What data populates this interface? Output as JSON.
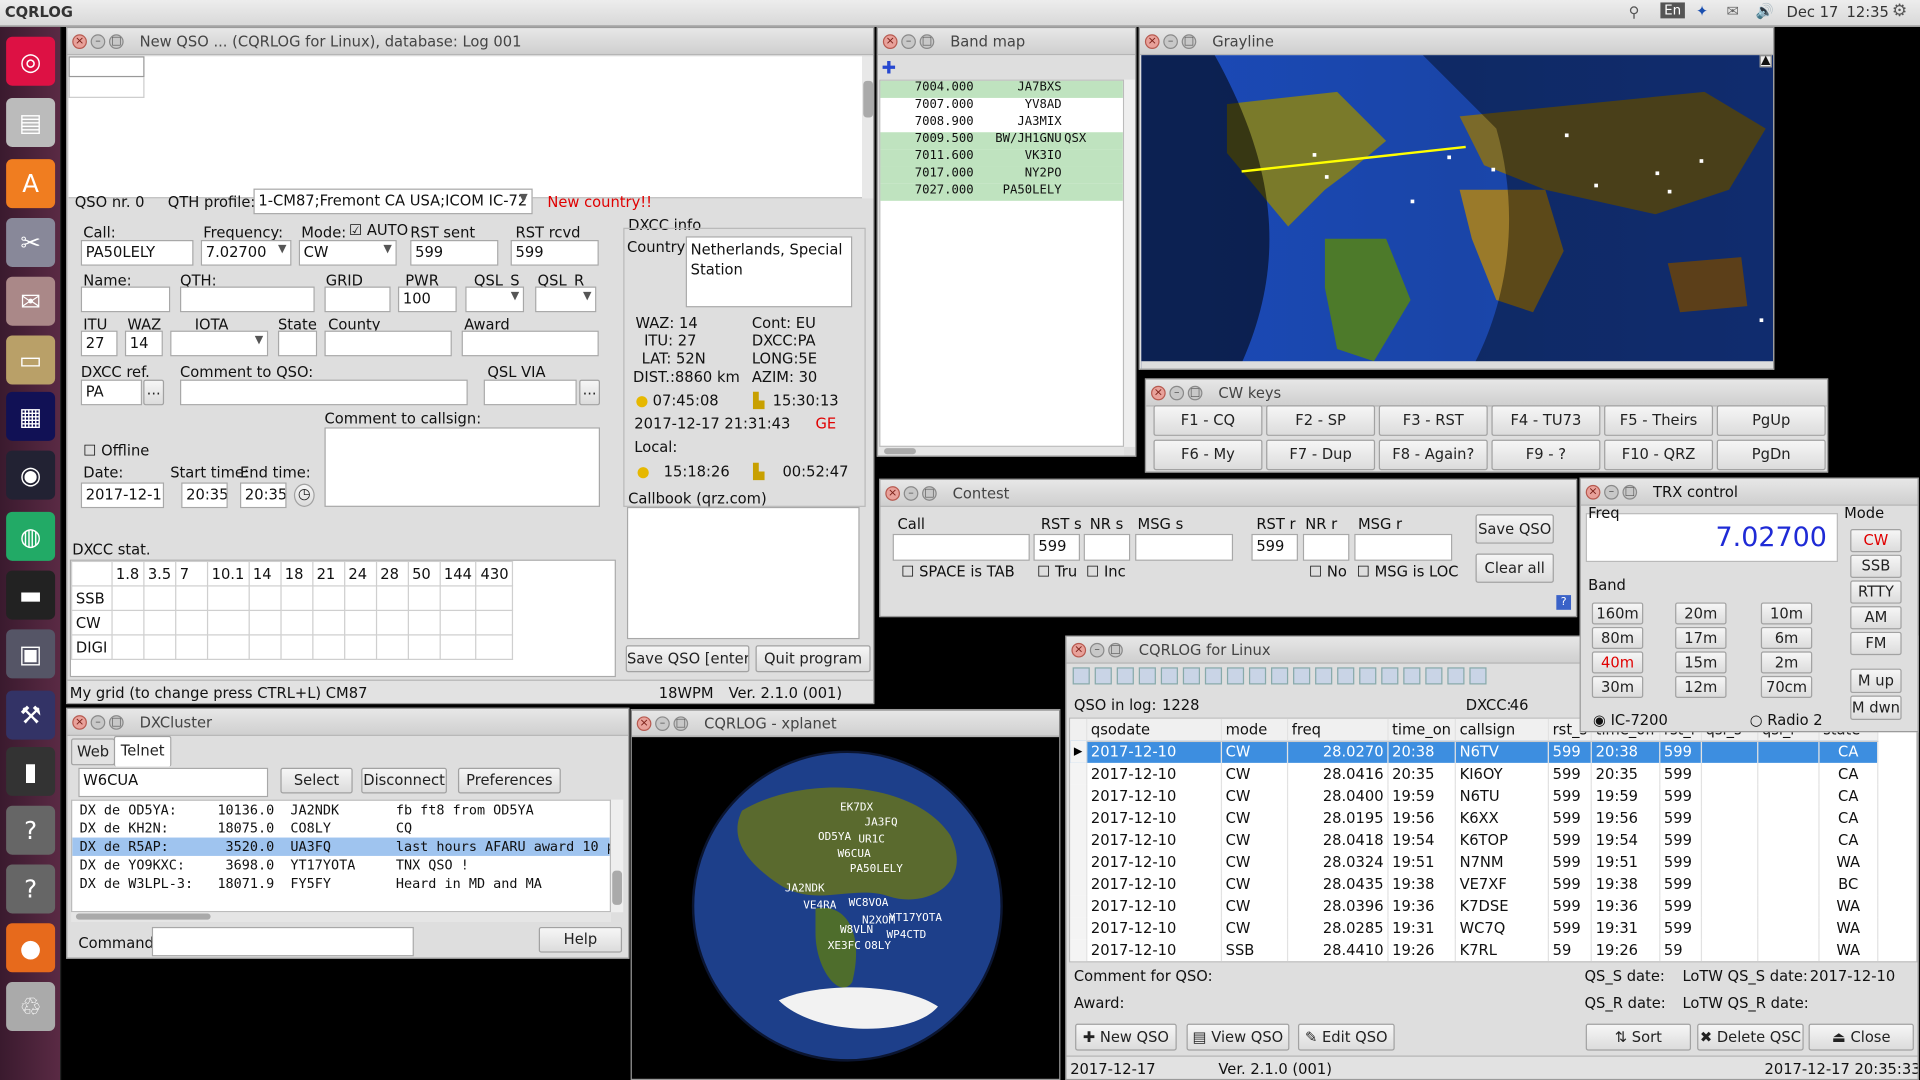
{
  "topbar": {
    "app": "CQRLOG",
    "lang": "En",
    "date": "Dec 17",
    "time": "12:35"
  },
  "colors": {
    "selection": "#3d8ee0",
    "bandmap_hl": "#bfe3bf",
    "freq_blue": "#1f2bd6",
    "red": "#e00000"
  },
  "launcher": {
    "icons": [
      "ubuntu-icon",
      "files-icon",
      "software-center-icon",
      "settings-icon",
      "mail-client-icon",
      "folder-icon",
      "audio-spectrum-icon",
      "radio-app-icon",
      "globe-icon",
      "terminal-app-icon",
      "sdr-app-icon",
      "toolbox-icon",
      "terminal-icon",
      "help-icon",
      "help-icon",
      "firefox-icon",
      "trash-icon"
    ]
  },
  "new_qso": {
    "title": "New QSO ... (CQRLOG for Linux), database: Log 001",
    "qso_nr": "QSO nr. 0",
    "qth_profile_label": "QTH profile:",
    "qth_profile": "1-CM87;Fremont CA USA;ICOM IC-72",
    "new_country": "New country!!",
    "labels": {
      "call": "Call:",
      "freq": "Frequency:",
      "mode": "Mode:",
      "auto": "AUTO",
      "rst_sent": "RST sent",
      "rst_rcvd": "RST rcvd",
      "name": "Name:",
      "qth": "QTH:",
      "grid": "GRID",
      "pwr": "PWR",
      "qsl_s": "QSL_S",
      "qsl_r": "QSL_R",
      "itu": "ITU",
      "waz": "WAZ",
      "iota": "IOTA",
      "state": "State",
      "county": "County",
      "award": "Award",
      "dxcc_ref": "DXCC ref.",
      "comment_qso": "Comment to QSO:",
      "qsl_via": "QSL VIA",
      "comment_call": "Comment to callsign:",
      "offline": "Offline",
      "date": "Date:",
      "start": "Start time:",
      "end": "End time:",
      "dxcc_info": "DXCC info",
      "country": "Country:",
      "callbook": "Callbook (qrz.com)",
      "dxcc_stat": "DXCC stat."
    },
    "values": {
      "call": "PA50LELY",
      "freq": "7.02700",
      "mode": "CW",
      "rst_sent": "599",
      "rst_rcvd": "599",
      "pwr": "100",
      "itu": "27",
      "waz": "14",
      "dxcc_ref": "PA",
      "date": "2017-12-17",
      "start": "20:35",
      "end": "20:35"
    },
    "country": "Netherlands, Special Station",
    "dxcc": {
      "waz": "WAZ: 14",
      "cont": "Cont:  EU",
      "itu": "ITU: 27",
      "dxcc": "DXCC:PA",
      "lat": "LAT: 52N",
      "long": "LONG:5E",
      "dist": "DIST.:8860 km",
      "azim": "AZIM:  30",
      "sunrise": "07:45:08",
      "sunset": "15:30:13",
      "datetime": "2017-12-17  21:31:43",
      "ge": "GE",
      "local": "Local:",
      "local_rise": "15:18:26",
      "local_set": "00:52:47"
    },
    "stat_header": [
      "",
      "1.8",
      "3.5",
      "7",
      "10.1",
      "14",
      "18",
      "21",
      "24",
      "28",
      "50",
      "144",
      "430"
    ],
    "stat_rows": [
      "SSB",
      "CW",
      "DIGI"
    ],
    "save_btn": "Save QSO [enter]",
    "quit_btn": "Quit program",
    "status": {
      "grid": "My grid (to change press CTRL+L) CM87",
      "wpm": "18WPM",
      "ver": "Ver. 2.1.0 (001)"
    }
  },
  "bandmap": {
    "title": "Band map",
    "rows": [
      {
        "freq": "7004.000",
        "call": "JA7BXS",
        "extra": "",
        "hl": true
      },
      {
        "freq": "7007.000",
        "call": "YV8AD",
        "extra": "",
        "hl": false
      },
      {
        "freq": "7008.900",
        "call": "JA3MIX",
        "extra": "",
        "hl": false
      },
      {
        "freq": "7009.500",
        "call": "BW/JH1GNU",
        "extra": "QSX",
        "hl": true
      },
      {
        "freq": "7011.600",
        "call": "VK3IO",
        "extra": "",
        "hl": true
      },
      {
        "freq": "7017.000",
        "call": "NY2PO",
        "extra": "",
        "hl": true
      },
      {
        "freq": "7027.000",
        "call": "PA50LELY",
        "extra": "",
        "hl": true
      }
    ]
  },
  "grayline": {
    "title": "Grayline"
  },
  "cwkeys": {
    "title": "CW keys",
    "keys": [
      "F1 - CQ",
      "F2 - SP",
      "F3 - RST",
      "F4 - TU73",
      "F5 - Theirs",
      "PgUp",
      "F6 - My",
      "F7 - Dup",
      "F8 - Again?",
      "F9 - ?",
      "F10 - QRZ",
      "PgDn"
    ]
  },
  "contest": {
    "title": "Contest",
    "call": "Call",
    "rst_s": "RST s",
    "nr_s": "NR s",
    "msg_s": "MSG s",
    "rst_r": "RST r",
    "nr_r": "NR r",
    "msg_r": "MSG r",
    "rst_s_val": "599",
    "rst_r_val": "599",
    "save": "Save QSO",
    "clear": "Clear all",
    "space": "SPACE is TAB",
    "tru": "Tru",
    "inc": "Inc",
    "no": "No",
    "msgloc": "MSG is LOC"
  },
  "trx": {
    "title": "TRX control",
    "freq_label": "Freq",
    "freq": "7.02700",
    "band_label": "Band",
    "mode_label": "Mode",
    "bands": [
      "160m",
      "20m",
      "10m",
      "80m",
      "17m",
      "6m",
      "40m",
      "15m",
      "2m",
      "30m",
      "12m",
      "70cm"
    ],
    "modes": [
      "CW",
      "SSB",
      "RTTY",
      "AM",
      "FM"
    ],
    "mup": "M up",
    "mdwn": "M dwn",
    "radio1": "IC-7200",
    "radio2": "Radio 2"
  },
  "dxcluster": {
    "title": "DXCluster",
    "tab_web": "Web",
    "tab_telnet": "Telnet",
    "server": "W6CUA",
    "select": "Select",
    "disconnect": "Disconnect",
    "prefs": "Preferences",
    "spots": [
      "DX de OD5YA:     10136.0  JA2NDK       fb ft8 from OD5YA",
      "DX de KH2N:      18075.0  CO8LY        CQ",
      "DX de R5AP:       3520.0  UA3FQ        last hours AFARU award 10 p",
      "DX de YO9KXC:     3698.0  YT17YOTA     TNX QSO !",
      "DX de W3LPL-3:   18071.9  FY5FY        Heard in MD and MA"
    ],
    "selected": 2,
    "command": "Command:",
    "help": "Help"
  },
  "xplanet": {
    "title": "CQRLOG - xplanet",
    "calls": [
      "EK7DX",
      "JA3FQ",
      "OD5YA",
      "W6CUA",
      "PA50LELY",
      "JA2NDK",
      "VE4RA",
      "WC8VOA",
      "N2XOM",
      "W8VLN",
      "WP4CTD",
      "XE3FC",
      "O8LY",
      "YT17YOTA",
      "UR1C"
    ]
  },
  "log": {
    "title": "CQRLOG for Linux",
    "qso_in_log_label": "QSO in log:",
    "qso_in_log": "1228",
    "dxcc_label": "DXCC:",
    "dxcc": "46",
    "columns": [
      "qsodate",
      "mode",
      "freq",
      "time_on",
      "callsign",
      "rst_s",
      "time_off",
      "rst_r",
      "qsl_s",
      "qsl_r",
      "state"
    ],
    "rows": [
      [
        "2017-12-10",
        "CW",
        "28.0270",
        "20:38",
        "N6TV",
        "599",
        "20:38",
        "599",
        "",
        "",
        "CA"
      ],
      [
        "2017-12-10",
        "CW",
        "28.0416",
        "20:35",
        "KI6OY",
        "599",
        "20:35",
        "599",
        "",
        "",
        "CA"
      ],
      [
        "2017-12-10",
        "CW",
        "28.0400",
        "19:59",
        "N6TU",
        "599",
        "19:59",
        "599",
        "",
        "",
        "CA"
      ],
      [
        "2017-12-10",
        "CW",
        "28.0195",
        "19:56",
        "K6XX",
        "599",
        "19:56",
        "599",
        "",
        "",
        "CA"
      ],
      [
        "2017-12-10",
        "CW",
        "28.0418",
        "19:54",
        "K6TOP",
        "599",
        "19:54",
        "599",
        "",
        "",
        "CA"
      ],
      [
        "2017-12-10",
        "CW",
        "28.0324",
        "19:51",
        "N7NM",
        "599",
        "19:51",
        "599",
        "",
        "",
        "WA"
      ],
      [
        "2017-12-10",
        "CW",
        "28.0435",
        "19:38",
        "VE7XF",
        "599",
        "19:38",
        "599",
        "",
        "",
        "BC"
      ],
      [
        "2017-12-10",
        "CW",
        "28.0396",
        "19:36",
        "K7DSE",
        "599",
        "19:36",
        "599",
        "",
        "",
        "WA"
      ],
      [
        "2017-12-10",
        "CW",
        "28.0285",
        "19:31",
        "WC7Q",
        "599",
        "19:31",
        "599",
        "",
        "",
        "WA"
      ],
      [
        "2017-12-10",
        "SSB",
        "28.4410",
        "19:26",
        "K7RL",
        "59",
        "19:26",
        "59",
        "",
        "",
        "WA"
      ]
    ],
    "selected": 0,
    "comment": "Comment for QSO:",
    "award": "Award:",
    "qss": "QS_S date:",
    "qsr": "QS_R date:",
    "lotw_s": "LoTW QS_S date:",
    "lotw_s_val": "2017-12-10",
    "lotw_r": "LoTW QS_R date:",
    "btn_new": "New QSO",
    "btn_view": "View QSO",
    "btn_edit": "Edit QSO",
    "btn_sort": "Sort",
    "btn_delete": "Delete QSC",
    "btn_close": "Close",
    "status_date": "2017-12-17",
    "status_ver": "Ver. 2.1.0 (001)",
    "status_dt": "2017-12-17  20:35:33"
  }
}
